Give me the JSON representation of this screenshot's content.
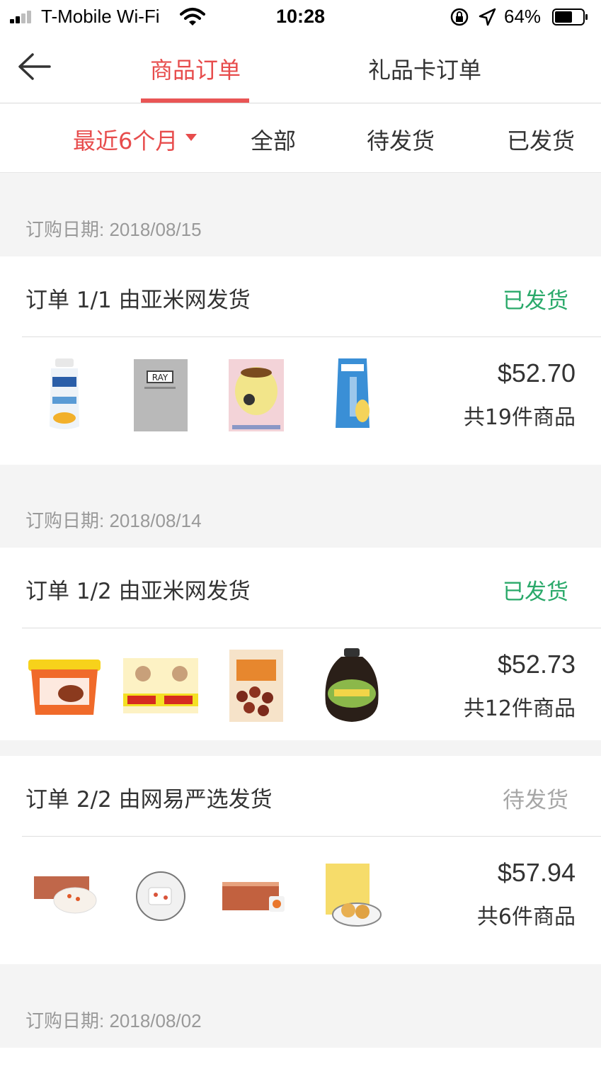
{
  "status_bar": {
    "carrier": "T-Mobile Wi-Fi",
    "time": "10:28",
    "battery_percent": "64%",
    "battery_level": 0.64
  },
  "header": {
    "back_icon": "arrow-left-icon",
    "tabs": [
      {
        "label": "商品订单",
        "active": true
      },
      {
        "label": "礼品卡订单",
        "active": false
      }
    ]
  },
  "filters": {
    "period": "最近6个月",
    "items": [
      "全部",
      "待发货",
      "已发货"
    ]
  },
  "groups": [
    {
      "date": "订购日期: 2018/08/15",
      "orders": [
        {
          "title": "订单 1/1 由亚米网发货",
          "status": "已发货",
          "price": "$52.70",
          "count": "共19件商品",
          "products": [
            "milk-bottle-icon",
            "face-mask-icon",
            "honey-mask-icon",
            "milk-carton-icon"
          ]
        }
      ]
    },
    {
      "date": "订购日期: 2018/08/14",
      "orders": [
        {
          "title": "订单 1/2 由亚米网发货",
          "status": "已发货",
          "price": "$52.73",
          "count": "共12件商品",
          "products": [
            "sauce-tub-icon",
            "spicy-snack-pack-icon",
            "dates-bag-icon",
            "jam-jar-icon"
          ]
        },
        {
          "title": "订单 2/2 由网易严选发货",
          "status": "待发货",
          "price": "$57.94",
          "count": "共6件商品",
          "products": [
            "dessert-box-icon",
            "rice-cake-plate-icon",
            "snack-box-icon",
            "pastry-plate-icon"
          ]
        }
      ]
    },
    {
      "date": "订购日期: 2018/08/02",
      "orders": []
    }
  ],
  "colors": {
    "accent": "#e74c4c",
    "shipped": "#2aa96a",
    "pending": "#a6a6a6",
    "background": "#f4f4f4"
  }
}
